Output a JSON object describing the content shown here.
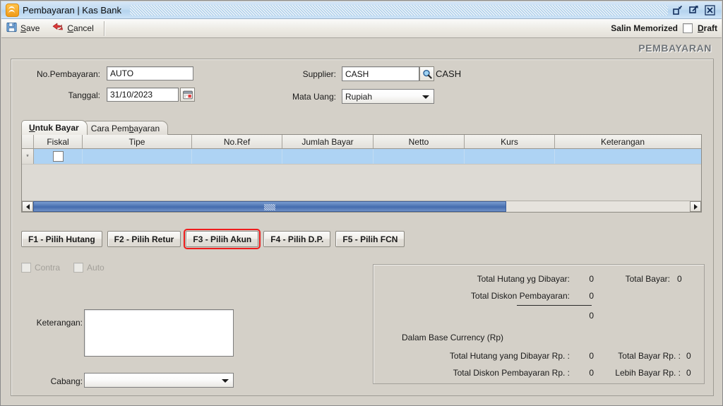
{
  "window": {
    "title": "Pembayaran | Kas Bank",
    "app_icon": "chevrons-up-icon",
    "controls": {
      "restore": "restore-icon",
      "maximize": "maximize-icon",
      "close": "close-icon"
    }
  },
  "toolbar": {
    "save_label": "Save",
    "save_accel": "S",
    "cancel_label": "Cancel",
    "cancel_accel": "C",
    "salin_memorized_label": "Salin Memorized",
    "draft_label": "Draft",
    "draft_accel": "D",
    "draft_checked": false
  },
  "header": {
    "title": "PEMBAYARAN"
  },
  "form": {
    "no_pembayaran_label": "No.Pembayaran:",
    "no_pembayaran_value": "AUTO",
    "tanggal_label": "Tanggal:",
    "tanggal_value": "31/10/2023",
    "calendar_icon": "calendar-icon",
    "supplier_label": "Supplier:",
    "supplier_value": "CASH",
    "supplier_lookup_icon": "magnifier-icon",
    "supplier_name": "CASH",
    "mata_uang_label": "Mata Uang:",
    "mata_uang_value": "Rupiah"
  },
  "tabs": [
    {
      "label": "Untuk Bayar",
      "active": true
    },
    {
      "label": "Cara Pembayaran",
      "active": false
    }
  ],
  "grid": {
    "columns": [
      "Fiskal",
      "Tipe",
      "No.Ref",
      "Jumlah Bayar",
      "Netto",
      "Kurs",
      "Keterangan"
    ],
    "rows": [
      {
        "marker": "*",
        "fiskal": "",
        "tipe": "",
        "noref": "",
        "jumlah_bayar": "",
        "netto": "",
        "kurs": "",
        "keterangan": ""
      }
    ],
    "scroll_left_icon": "arrow-left-icon",
    "scroll_right_icon": "arrow-right-icon"
  },
  "function_buttons": [
    {
      "label": "F1 - Pilih Hutang",
      "highlighted": false
    },
    {
      "label": "F2 - Pilih Retur",
      "highlighted": false
    },
    {
      "label": "F3 - Pilih Akun",
      "highlighted": true
    },
    {
      "label": "F4 - Pilih D.P.",
      "highlighted": false
    },
    {
      "label": "F5 - Pilih FCN",
      "highlighted": false
    }
  ],
  "options": {
    "contra_label": "Contra",
    "contra_checked": false,
    "contra_disabled": true,
    "auto_label": "Auto",
    "auto_checked": false,
    "auto_disabled": true
  },
  "bottom": {
    "keterangan_label": "Keterangan:",
    "keterangan_value": "",
    "cabang_label": "Cabang:",
    "cabang_value": ""
  },
  "totals": {
    "total_hutang_label": "Total Hutang yg Dibayar:",
    "total_hutang_value": "0",
    "total_diskon_label": "Total Diskon Pembayaran:",
    "total_diskon_value": "0",
    "subtotal_value": "0",
    "total_bayar_label": "Total Bayar:",
    "total_bayar_value": "0",
    "base_currency_label": "Dalam Base Currency (Rp)",
    "total_hutang_rp_label": "Total Hutang yang Dibayar Rp. :",
    "total_hutang_rp_value": "0",
    "total_diskon_rp_label": "Total Diskon Pembayaran Rp. :",
    "total_diskon_rp_value": "0",
    "total_bayar_rp_label": "Total Bayar Rp. :",
    "total_bayar_rp_value": "0",
    "lebih_bayar_rp_label": "Lebih Bayar Rp. :",
    "lebih_bayar_rp_value": "0"
  },
  "colors": {
    "titlebar": "#bcd9f2",
    "panel": "#d4d0c8",
    "grid_row_selected": "#aed3f4",
    "highlight_outline": "#ee1c1c",
    "header_title": "#6f7478",
    "scrollbar_thumb": "#4d75b5"
  }
}
